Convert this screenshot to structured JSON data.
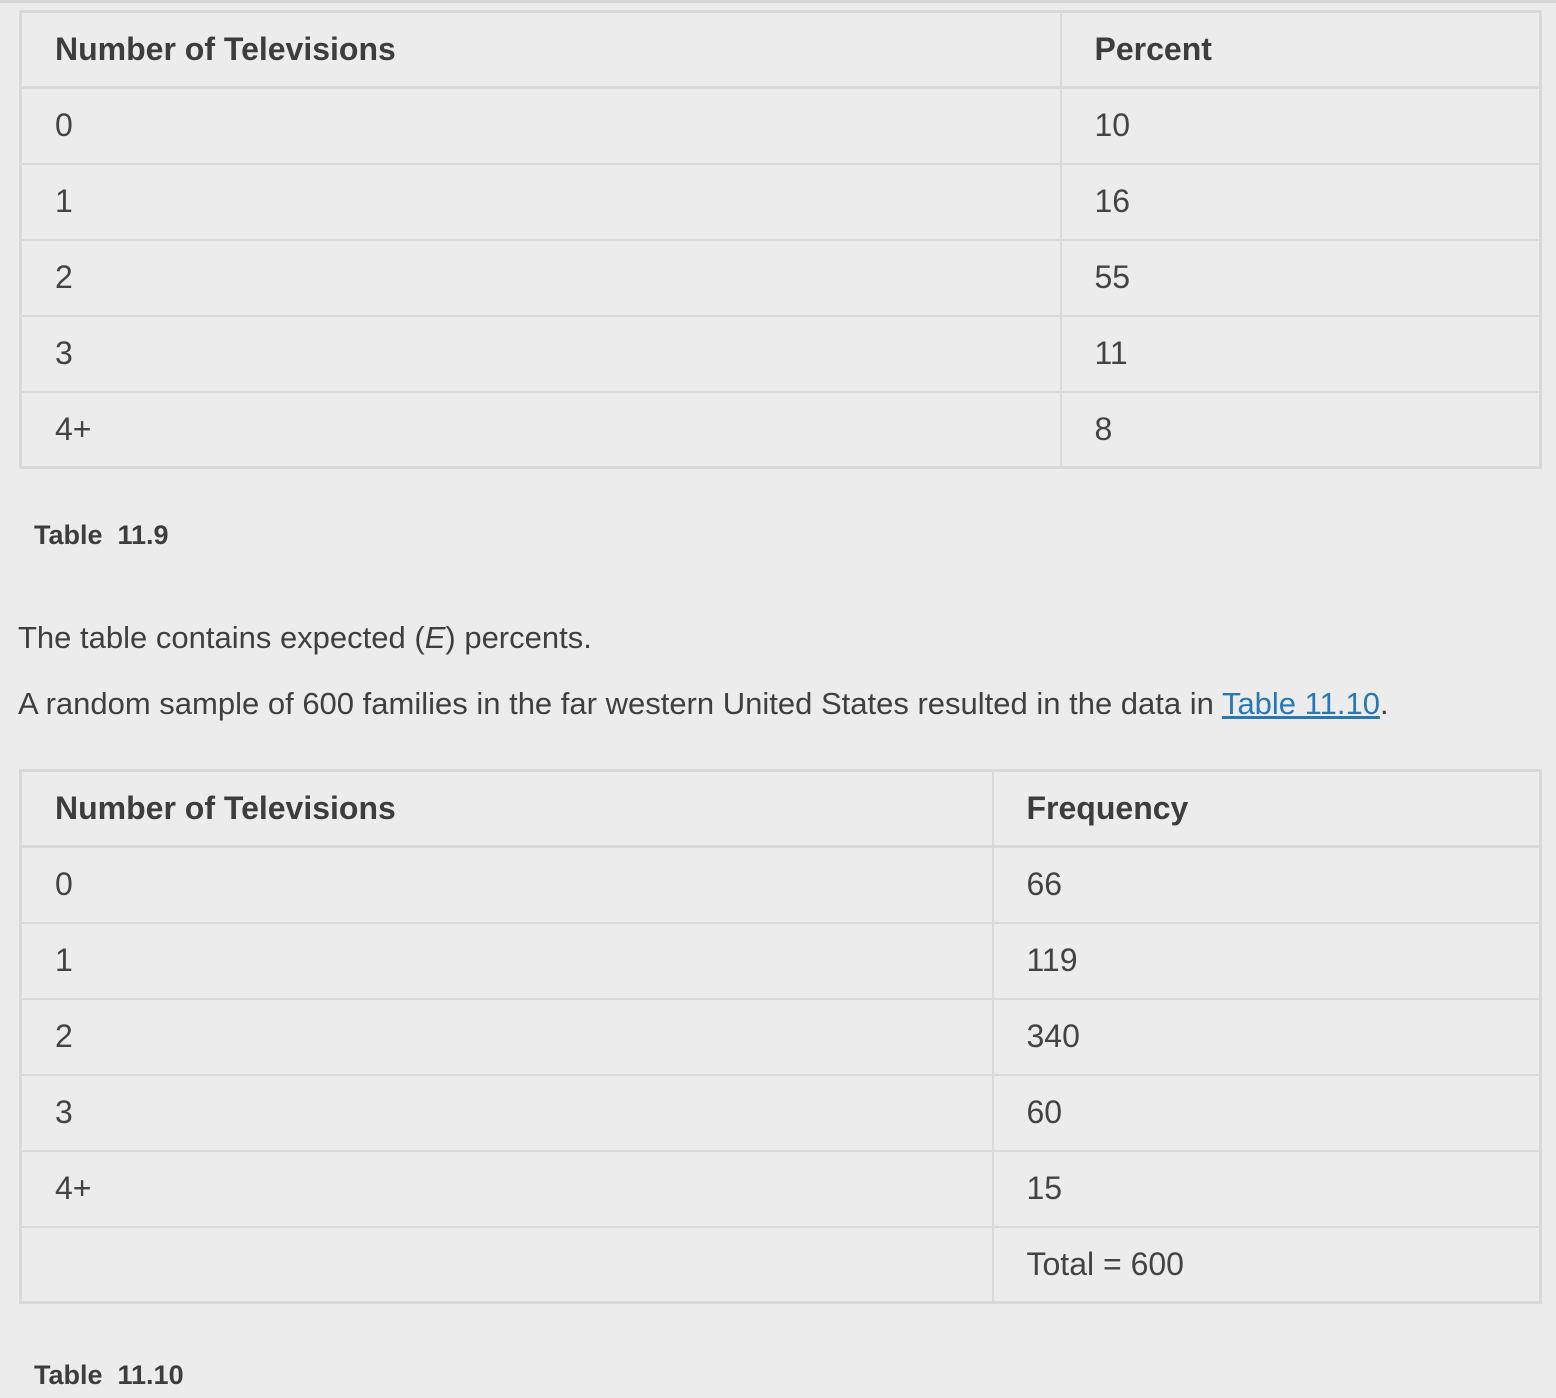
{
  "table1": {
    "headers": [
      "Number of Televisions",
      "Percent"
    ],
    "rows": [
      [
        "0",
        "10"
      ],
      [
        "1",
        "16"
      ],
      [
        "2",
        "55"
      ],
      [
        "3",
        "11"
      ],
      [
        "4+",
        "8"
      ]
    ],
    "caption": "Table  11.9"
  },
  "paragraph1": {
    "before": "The table contains expected (",
    "symbol": "E",
    "after": ") percents."
  },
  "paragraph2": {
    "text": "A random sample of 600 families in the far western United States resulted in the data in ",
    "link": "Table 11.10",
    "after": "."
  },
  "table2": {
    "headers": [
      "Number of Televisions",
      "Frequency"
    ],
    "rows": [
      [
        "0",
        "66"
      ],
      [
        "1",
        "119"
      ],
      [
        "2",
        "340"
      ],
      [
        "3",
        "60"
      ],
      [
        "4+",
        "15"
      ],
      [
        "",
        "Total = 600"
      ]
    ],
    "caption": "Table  11.10"
  }
}
